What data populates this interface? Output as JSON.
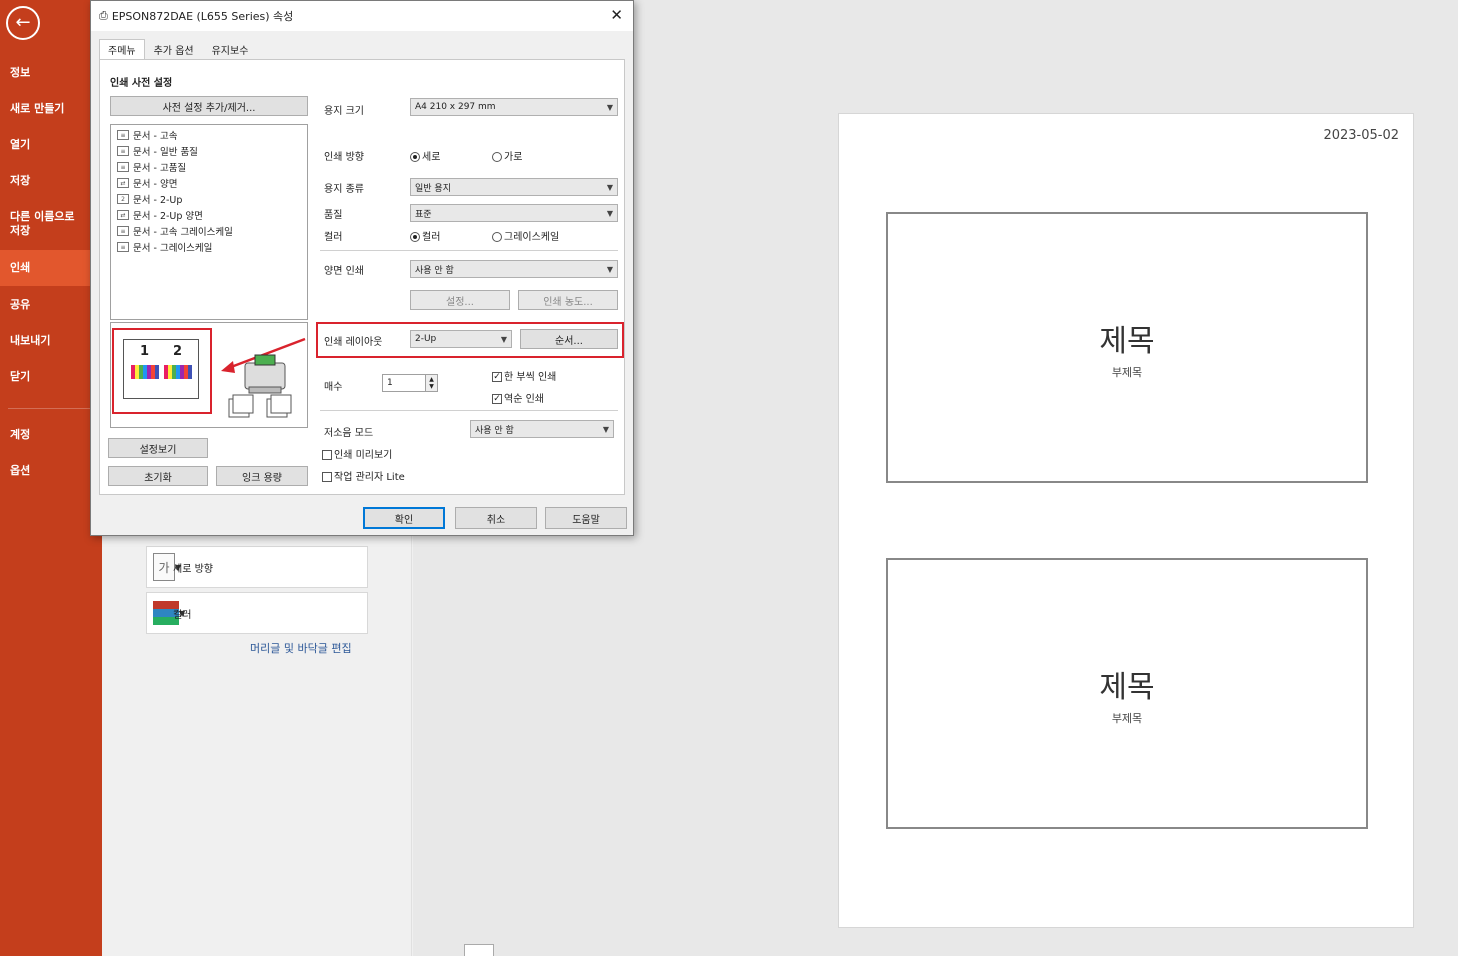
{
  "sidebar": {
    "back_icon": "arrow-left-icon",
    "items": [
      {
        "label": "정보"
      },
      {
        "label": "새로 만들기"
      },
      {
        "label": "열기"
      },
      {
        "label": "저장"
      },
      {
        "label": "다른 이름으로 저장"
      },
      {
        "label": "인쇄",
        "active": true
      },
      {
        "label": "공유"
      },
      {
        "label": "내보내기"
      },
      {
        "label": "닫기"
      },
      {
        "label": "계정"
      },
      {
        "label": "옵션"
      }
    ]
  },
  "print_settings": {
    "orientation_label": "세로 방향",
    "color_label": "컬러",
    "header_footer_link": "머리글 및 바닥글 편집"
  },
  "preview": {
    "date": "2023-05-02",
    "slides": [
      {
        "title": "제목",
        "subtitle": "부제목"
      },
      {
        "title": "제목",
        "subtitle": "부제목"
      }
    ]
  },
  "dialog": {
    "title": "EPSON872DAE (L655 Series) 속성",
    "close_icon": "close-icon",
    "tabs": [
      "주메뉴",
      "추가 옵션",
      "유지보수"
    ],
    "section_title": "인쇄 사전 설정",
    "preset_button": "사전 설정 추가/제거...",
    "presets": [
      "문서 - 고속",
      "문서 - 일반 품질",
      "문서 - 고품질",
      "문서 - 양면",
      "문서 - 2-Up",
      "문서 - 2-Up 양면",
      "문서 - 고속 그레이스케일",
      "문서 - 그레이스케일"
    ],
    "show_settings_button": "설정보기",
    "reset_button": "초기화",
    "ink_level_button": "잉크 용량",
    "paper_size_label": "용지 크기",
    "paper_size_value": "A4 210 x 297 mm",
    "orientation_label": "인쇄 방향",
    "orientation_portrait": "세로",
    "orientation_landscape": "가로",
    "paper_type_label": "용지 종류",
    "paper_type_value": "일반 용지",
    "quality_label": "품질",
    "quality_value": "표준",
    "color_label": "컬러",
    "color_option": "컬러",
    "grayscale_option": "그레이스케일",
    "duplex_label": "양면 인쇄",
    "duplex_value": "사용 안 함",
    "settings_button": "설정...",
    "print_density_button": "인쇄 농도...",
    "multi_page_label": "인쇄 레이아웃",
    "multi_page_value": "2-Up",
    "order_button": "순서...",
    "copies_label": "매수",
    "copies_value": "1",
    "collate_label": "한 부씩 인쇄",
    "reverse_label": "역순 인쇄",
    "quiet_mode_label": "저소음 모드",
    "quiet_mode_value": "사용 안 함",
    "print_preview_label": "인쇄 미리보기",
    "job_arranger_label": "작업 관리자 Lite",
    "ok_button": "확인",
    "cancel_button": "취소",
    "help_button": "도움말",
    "layout_page_numbers": [
      "1",
      "2"
    ],
    "highlight_color": "#d9232d"
  }
}
